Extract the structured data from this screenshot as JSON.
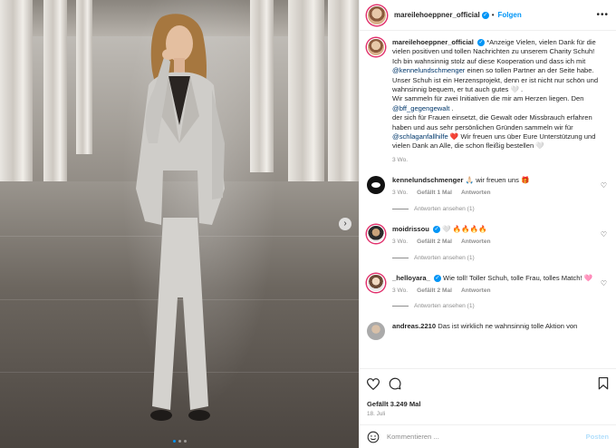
{
  "post": {
    "username": "mareilehoeppner_official",
    "follow_label": "Folgen",
    "more": "•••"
  },
  "photo": {
    "slides_total": 3,
    "active_slide": 1
  },
  "caption": {
    "username": "mareilehoeppner_official",
    "p1": "*Anzeige Vielen, vielen Dank für die vielen positiven und tollen Nachrichten zu unserem Charity Schuh!",
    "p2a": "Ich bin wahnsinnig stolz auf diese Kooperation und dass ich mit",
    "p2_link": "@kennelundschmenger",
    "p2b": "einen so tollen Partner an der Seite habe.",
    "p3": "Unser Schuh ist ein Herzensprojekt, denn er ist nicht nur schön und wahnsinnig bequem, er tut auch gutes 🤍 .",
    "p4a": "Wir sammeln für zwei Initiativen die mir am Herzen liegen. Den",
    "p4_link": "@bff_gegengewalt",
    "p4b": ".",
    "p5a": "der sich für Frauen einsetzt, die Gewalt oder Missbrauch erfahren haben und aus sehr persönlichen Gründen sammeln wir für",
    "p5_link": "@schlaganfallhilfe",
    "p5b": "❤️  Wir freuen uns über Eure Unterstützung und vielen Dank an Alle, die schon fleißig bestellen 🤍",
    "time": "3 Wo."
  },
  "comments": [
    {
      "username": "kennelundschmenger",
      "text": "🙏🏻 wir freuen uns 🎁",
      "time": "3 Wo.",
      "likes": "Gefällt 1 Mal",
      "reply": "Antworten",
      "view_replies": "Antworten ansehen (1)"
    },
    {
      "username": "moidrissou",
      "text": "🤍 🔥🔥🔥🔥",
      "time": "3 Wo.",
      "likes": "Gefällt 2 Mal",
      "reply": "Antworten",
      "view_replies": "Antworten ansehen (1)"
    },
    {
      "username": "_helloyara_",
      "text": "Wie toll! Toller Schuh, tolle Frau, tolles Match! 🩷",
      "time": "3 Wo.",
      "likes": "Gefällt 2 Mal",
      "reply": "Antworten",
      "view_replies": "Antworten ansehen (1)"
    },
    {
      "username": "andreas.2210",
      "text": "Das ist wirklich ne wahnsinnig tolle Aktion von"
    }
  ],
  "footer": {
    "likes": "Gefällt 3.249 Mal",
    "date": "18. Juli",
    "comment_placeholder": "Kommentieren ...",
    "post_label": "Posten"
  },
  "colors": {
    "accent": "#0095f6",
    "link": "#00376b",
    "muted": "#8e8e8e"
  }
}
